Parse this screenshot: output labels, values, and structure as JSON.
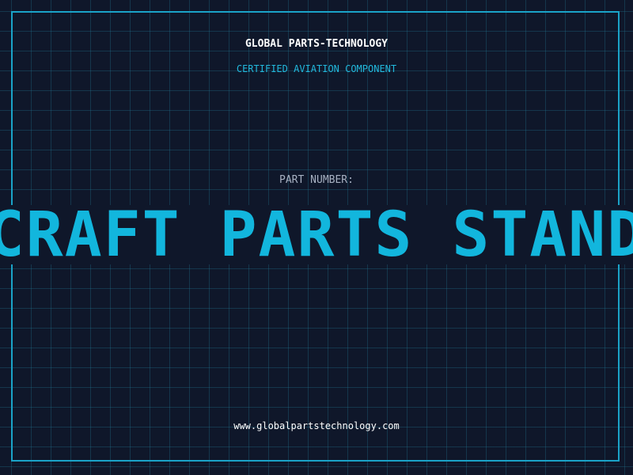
{
  "header": {
    "company": "GLOBAL PARTS-TECHNOLOGY",
    "tagline": "CERTIFIED AVIATION COMPONENT"
  },
  "main": {
    "part_label": "PART NUMBER:",
    "part_number": "AIRCRAFT PARTS STANDARD"
  },
  "footer": {
    "url": "www.globalpartstechnology.com"
  },
  "colors": {
    "background": "#0f172a",
    "grid": "#1f5e75",
    "frame": "#1aa3c8",
    "accent": "#12b6dd",
    "label": "#a7b1c2",
    "text": "#ffffff"
  }
}
